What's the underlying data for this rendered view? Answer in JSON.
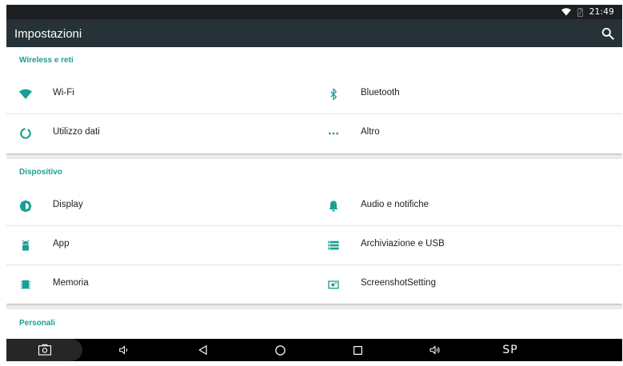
{
  "status_bar": {
    "time": "21:49",
    "wifi_icon": "wifi-icon",
    "battery_icon": "battery-icon"
  },
  "action_bar": {
    "title": "Impostazioni",
    "search_icon": "search-icon"
  },
  "accent_color": "#1a9f93",
  "categories": [
    {
      "title": "Wireless e reti",
      "items": [
        {
          "label": "Wi-Fi",
          "icon": "wifi-icon"
        },
        {
          "label": "Bluetooth",
          "icon": "bluetooth-icon"
        },
        {
          "label": "Utilizzo dati",
          "icon": "data-usage-icon"
        },
        {
          "label": "Altro",
          "icon": "more-icon"
        }
      ]
    },
    {
      "title": "Dispositivo",
      "items": [
        {
          "label": "Display",
          "icon": "brightness-icon"
        },
        {
          "label": "Audio e notifiche",
          "icon": "bell-icon"
        },
        {
          "label": "App",
          "icon": "android-icon"
        },
        {
          "label": "Archiviazione e USB",
          "icon": "storage-icon"
        },
        {
          "label": "Memoria",
          "icon": "memory-icon"
        },
        {
          "label": "ScreenshotSetting",
          "icon": "screenshot-icon"
        }
      ]
    },
    {
      "title": "Personali",
      "items": []
    }
  ],
  "nav_bar": {
    "buttons": [
      {
        "icon": "screenshot-icon"
      },
      {
        "icon": "volume-down-icon"
      },
      {
        "icon": "back-icon"
      },
      {
        "icon": "home-icon"
      },
      {
        "icon": "recents-icon"
      },
      {
        "icon": "volume-up-icon"
      }
    ],
    "sp_label": "SP"
  }
}
